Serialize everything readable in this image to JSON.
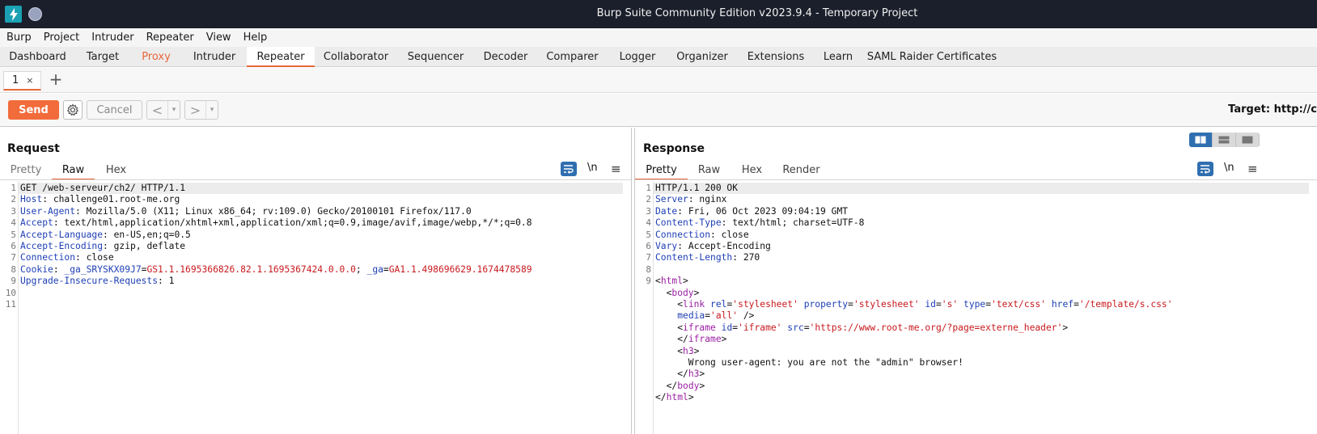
{
  "window": {
    "title": "Burp Suite Community Edition v2023.9.4 - Temporary Project"
  },
  "menu": [
    "Burp",
    "Project",
    "Intruder",
    "Repeater",
    "View",
    "Help"
  ],
  "tabs": [
    {
      "label": "Dashboard"
    },
    {
      "label": "Target"
    },
    {
      "label": "Proxy"
    },
    {
      "label": "Intruder"
    },
    {
      "label": "Repeater"
    },
    {
      "label": "Collaborator"
    },
    {
      "label": "Sequencer"
    },
    {
      "label": "Decoder"
    },
    {
      "label": "Comparer"
    },
    {
      "label": "Logger"
    },
    {
      "label": "Organizer"
    },
    {
      "label": "Extensions"
    },
    {
      "label": "Learn"
    },
    {
      "label": "SAML Raider Certificates"
    }
  ],
  "active_tab": "Repeater",
  "highlighted_tab": "Proxy",
  "subtab": {
    "label": "1",
    "close": "×",
    "add": "+"
  },
  "toolbar": {
    "send": "Send",
    "cancel": "Cancel",
    "prev": "<",
    "next": ">",
    "drop": "▾",
    "target": "Target: http://c"
  },
  "request": {
    "title": "Request",
    "tabs": [
      "Pretty",
      "Raw",
      "Hex"
    ],
    "active_tab": "Raw",
    "newline_label": "\\n",
    "lines": [
      [
        [
          "v",
          "GET /web-serveur/ch2/ HTTP/1.1"
        ]
      ],
      [
        [
          "k",
          "Host"
        ],
        [
          "v",
          ": challenge01.root-me.org"
        ]
      ],
      [
        [
          "k",
          "User-Agent"
        ],
        [
          "v",
          ": Mozilla/5.0 (X11; Linux x86_64; rv:109.0) Gecko/20100101 Firefox/117.0"
        ]
      ],
      [
        [
          "k",
          "Accept"
        ],
        [
          "v",
          ": text/html,application/xhtml+xml,application/xml;q=0.9,image/avif,image/webp,*/*;q=0.8"
        ]
      ],
      [
        [
          "k",
          "Accept-Language"
        ],
        [
          "v",
          ": en-US,en;q=0.5"
        ]
      ],
      [
        [
          "k",
          "Accept-Encoding"
        ],
        [
          "v",
          ": gzip, deflate"
        ]
      ],
      [
        [
          "k",
          "Connection"
        ],
        [
          "v",
          ": close"
        ]
      ],
      [
        [
          "k",
          "Cookie"
        ],
        [
          "v",
          ": "
        ],
        [
          "k",
          "_ga_SRYSKX09J7"
        ],
        [
          "v",
          "="
        ],
        [
          "cv",
          "GS1.1.1695366826.82.1.1695367424.0.0.0"
        ],
        [
          "v",
          "; "
        ],
        [
          "k",
          "_ga"
        ],
        [
          "v",
          "="
        ],
        [
          "cv",
          "GA1.1.498696629.1674478589"
        ]
      ],
      [
        [
          "k",
          "Upgrade-Insecure-Requests"
        ],
        [
          "v",
          ": 1"
        ]
      ],
      [],
      []
    ]
  },
  "response": {
    "title": "Response",
    "tabs": [
      "Pretty",
      "Raw",
      "Hex",
      "Render"
    ],
    "active_tab": "Pretty",
    "newline_label": "\\n",
    "lines": [
      {
        "n": "1",
        "parts": [
          [
            "v",
            "HTTP/1.1 200 OK"
          ]
        ]
      },
      {
        "n": "2",
        "parts": [
          [
            "k",
            "Server"
          ],
          [
            "v",
            ": nginx"
          ]
        ]
      },
      {
        "n": "3",
        "parts": [
          [
            "k",
            "Date"
          ],
          [
            "v",
            ": Fri, 06 Oct 2023 09:04:19 GMT"
          ]
        ]
      },
      {
        "n": "4",
        "parts": [
          [
            "k",
            "Content-Type"
          ],
          [
            "v",
            ": text/html; charset=UTF-8"
          ]
        ]
      },
      {
        "n": "5",
        "parts": [
          [
            "k",
            "Connection"
          ],
          [
            "v",
            ": close"
          ]
        ]
      },
      {
        "n": "6",
        "parts": [
          [
            "k",
            "Vary"
          ],
          [
            "v",
            ": Accept-Encoding"
          ]
        ]
      },
      {
        "n": "7",
        "parts": [
          [
            "k",
            "Content-Length"
          ],
          [
            "v",
            ": 270"
          ]
        ]
      },
      {
        "n": "8",
        "parts": []
      },
      {
        "n": "9",
        "parts": [
          [
            "v",
            "<"
          ],
          [
            "tag",
            "html"
          ],
          [
            "v",
            ">"
          ]
        ]
      },
      {
        "n": "",
        "parts": [
          [
            "v",
            "  <"
          ],
          [
            "tag",
            "body"
          ],
          [
            "v",
            ">"
          ]
        ]
      },
      {
        "n": "",
        "parts": [
          [
            "v",
            "    <"
          ],
          [
            "tag",
            "link"
          ],
          [
            "v",
            " "
          ],
          [
            "attr",
            "rel"
          ],
          [
            "v",
            "="
          ],
          [
            "str",
            "'stylesheet'"
          ],
          [
            "v",
            " "
          ],
          [
            "attr",
            "property"
          ],
          [
            "v",
            "="
          ],
          [
            "str",
            "'stylesheet'"
          ],
          [
            "v",
            " "
          ],
          [
            "attr",
            "id"
          ],
          [
            "v",
            "="
          ],
          [
            "str",
            "'s'"
          ],
          [
            "v",
            " "
          ],
          [
            "attr",
            "type"
          ],
          [
            "v",
            "="
          ],
          [
            "str",
            "'text/css'"
          ],
          [
            "v",
            " "
          ],
          [
            "attr",
            "href"
          ],
          [
            "v",
            "="
          ],
          [
            "str",
            "'/template/s.css'"
          ]
        ]
      },
      {
        "n": "",
        "parts": [
          [
            "v",
            "    "
          ],
          [
            "attr",
            "media"
          ],
          [
            "v",
            "="
          ],
          [
            "str",
            "'all'"
          ],
          [
            "v",
            " />"
          ]
        ]
      },
      {
        "n": "",
        "parts": [
          [
            "v",
            "    <"
          ],
          [
            "tag",
            "iframe"
          ],
          [
            "v",
            " "
          ],
          [
            "attr",
            "id"
          ],
          [
            "v",
            "="
          ],
          [
            "str",
            "'iframe'"
          ],
          [
            "v",
            " "
          ],
          [
            "attr",
            "src"
          ],
          [
            "v",
            "="
          ],
          [
            "str",
            "'https://www.root-me.org/?page=externe_header'"
          ],
          [
            "v",
            ">"
          ]
        ]
      },
      {
        "n": "",
        "parts": [
          [
            "v",
            "    </"
          ],
          [
            "tag",
            "iframe"
          ],
          [
            "v",
            ">"
          ]
        ]
      },
      {
        "n": "",
        "parts": [
          [
            "v",
            "    <"
          ],
          [
            "tag",
            "h3"
          ],
          [
            "v",
            ">"
          ]
        ]
      },
      {
        "n": "",
        "parts": [
          [
            "v",
            "      Wrong user-agent: you are not the \"admin\" browser!"
          ]
        ]
      },
      {
        "n": "",
        "parts": [
          [
            "v",
            "    </"
          ],
          [
            "tag",
            "h3"
          ],
          [
            "v",
            ">"
          ]
        ]
      },
      {
        "n": "",
        "parts": [
          [
            "v",
            "  </"
          ],
          [
            "tag",
            "body"
          ],
          [
            "v",
            ">"
          ]
        ]
      },
      {
        "n": "",
        "parts": [
          [
            "v",
            "</"
          ],
          [
            "tag",
            "html"
          ],
          [
            "v",
            ">"
          ]
        ]
      }
    ]
  },
  "colors": {
    "accent": "#f26b3a",
    "titlebar": "#1b1f2b",
    "blue": "#2f6fb0"
  }
}
